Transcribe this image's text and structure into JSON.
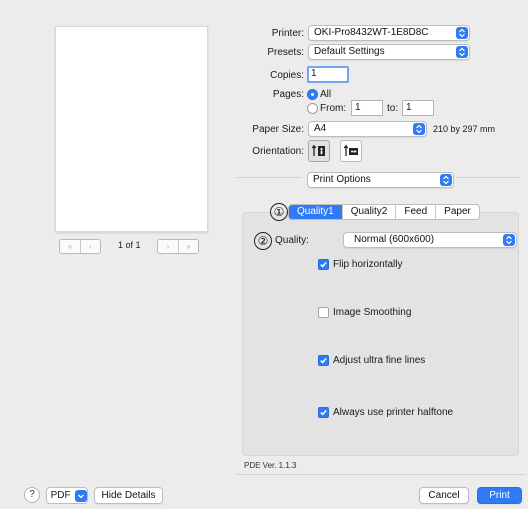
{
  "preview": {
    "page_count": "1 of 1",
    "nav_first": "«",
    "nav_prev": "‹",
    "nav_next": "›",
    "nav_last": "»"
  },
  "printer": {
    "label": "Printer:",
    "value": "OKI-Pro8432WT-1E8D8C"
  },
  "presets": {
    "label": "Presets:",
    "value": "Default Settings"
  },
  "copies": {
    "label": "Copies:",
    "value": "1"
  },
  "pages": {
    "label": "Pages:",
    "all_label": "All",
    "from_label": "From:",
    "from_value": "1",
    "to_label": "to:",
    "to_value": "1",
    "selected": "All"
  },
  "paper_size": {
    "label": "Paper Size:",
    "value": "A4",
    "dimensions": "210 by 297 mm"
  },
  "orientation": {
    "label": "Orientation:",
    "selected": "portrait"
  },
  "section_popup": {
    "value": "Print Options"
  },
  "annotations": {
    "marker1": "①",
    "marker2": "②"
  },
  "tabs": {
    "items": [
      "Quality1",
      "Quality2",
      "Feed",
      "Paper"
    ],
    "active": "Quality1"
  },
  "quality": {
    "label": "Quality:",
    "value": "Normal (600x600)"
  },
  "options": [
    {
      "label": "Flip horizontally",
      "checked": true
    },
    {
      "label": "Image Smoothing",
      "checked": false
    },
    {
      "label": "Adjust ultra fine lines",
      "checked": true
    },
    {
      "label": "Always use printer halftone",
      "checked": true
    }
  ],
  "version": "PDE Ver. 1.1.3",
  "bottom": {
    "help": "?",
    "pdf": "PDF",
    "hide_details": "Hide Details",
    "cancel": "Cancel",
    "print": "Print"
  },
  "colors": {
    "accent": "#2f7bf5",
    "background": "#ececec",
    "group_box": "#e3e3e3"
  }
}
